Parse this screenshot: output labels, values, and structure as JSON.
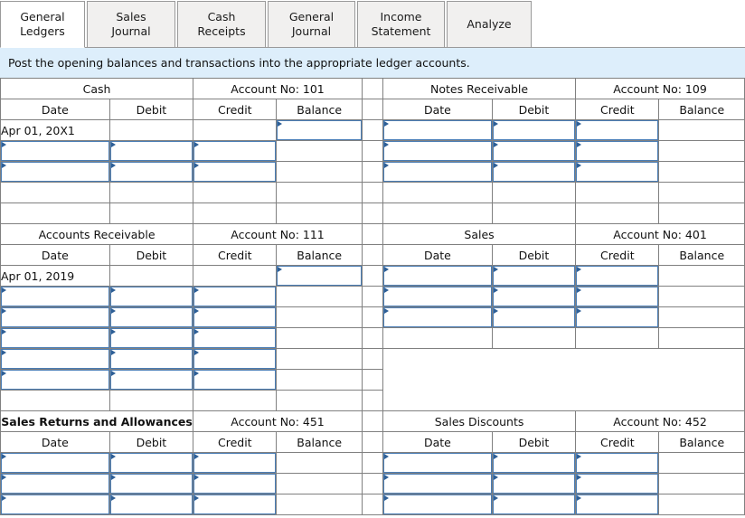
{
  "tabs": [
    {
      "label": "General\nLedgers",
      "active": true
    },
    {
      "label": "Sales Journal",
      "active": false
    },
    {
      "label": "Cash Receipts",
      "active": false
    },
    {
      "label": "General\nJournal",
      "active": false
    },
    {
      "label": "Income\nStatement",
      "active": false
    },
    {
      "label": "Analyze",
      "active": false
    }
  ],
  "instruction": {
    "text": "Post the opening balances and transactions into the appropriate ledger accounts."
  },
  "columns": {
    "date": "Date",
    "debit": "Debit",
    "credit": "Credit",
    "balance": "Balance"
  },
  "colors": {
    "header_blue": "#78a9e0",
    "instruction_blue": "#ddeefb",
    "input_border": "#4a7db5",
    "marker": "#2e5f96",
    "grid_line": "#808080"
  },
  "accounts": {
    "cash": {
      "name": "Cash",
      "account_no": "Account No: 101",
      "bold_title": false
    },
    "notes_receivable": {
      "name": "Notes Receivable",
      "account_no": "Account No: 109",
      "bold_title": false
    },
    "accounts_receivable": {
      "name": "Accounts Receivable",
      "account_no": "Account No: 111",
      "bold_title": false
    },
    "sales": {
      "name": "Sales",
      "account_no": "Account No: 401",
      "bold_title": false
    },
    "sales_returns": {
      "name": "Sales Returns and Allowances",
      "account_no": "Account No: 451",
      "bold_title": true
    },
    "sales_discounts": {
      "name": "Sales Discounts",
      "account_no": "Account No: 452",
      "bold_title": false
    }
  },
  "entries": {
    "cash_opening_date": "Apr 01, 20X1",
    "accounts_receivable_opening_date": "Apr 01, 2019"
  }
}
